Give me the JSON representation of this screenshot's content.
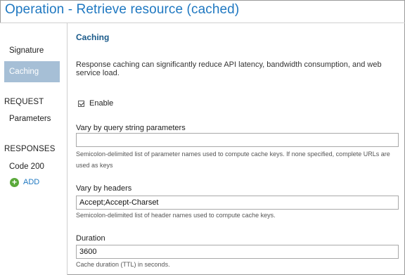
{
  "page": {
    "title": "Operation - Retrieve resource (cached)"
  },
  "sidebar": {
    "signature": "Signature",
    "caching": "Caching",
    "request_header": "REQUEST",
    "parameters": "Parameters",
    "responses_header": "RESPONSES",
    "code_200": "Code 200",
    "add_label": "ADD",
    "add_icon": "+"
  },
  "main": {
    "heading": "Caching",
    "description": "Response caching can significantly reduce API latency, bandwidth consumption, and web service load.",
    "enable_label": "Enable",
    "enable_checked": true,
    "vary_query": {
      "label": "Vary by query string parameters",
      "value": "",
      "hint": "Semicolon-delimited list of parameter names used to compute cache keys. If none specified, complete URLs are used as keys"
    },
    "vary_headers": {
      "label": "Vary by headers",
      "value": "Accept;Accept-Charset",
      "hint": "Semicolon-delimited list of header names used to compute cache keys."
    },
    "duration": {
      "label": "Duration",
      "value": "3600",
      "hint": "Cache duration (TTL) in seconds."
    }
  },
  "colors": {
    "title": "#1f78c1",
    "active_nav": "#a6bfd6",
    "add_icon": "#5aa93a",
    "heading": "#1a5a8a"
  }
}
